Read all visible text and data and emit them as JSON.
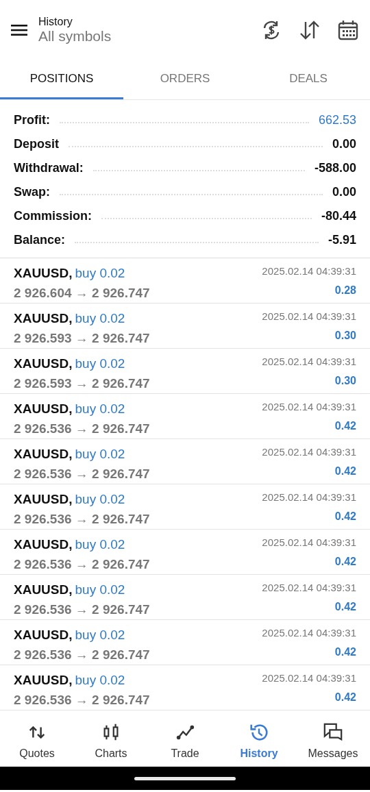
{
  "header": {
    "title": "History",
    "subtitle": "All symbols"
  },
  "tabs": [
    {
      "label": "POSITIONS",
      "selected": true
    },
    {
      "label": "ORDERS",
      "selected": false
    },
    {
      "label": "DEALS",
      "selected": false
    }
  ],
  "summary": [
    {
      "label": "Profit:",
      "value": "662.53",
      "kind": "highlight"
    },
    {
      "label": "Deposit",
      "value": "0.00",
      "kind": "plain"
    },
    {
      "label": "Withdrawal:",
      "value": "-588.00",
      "kind": "plain"
    },
    {
      "label": "Swap:",
      "value": "0.00",
      "kind": "plain"
    },
    {
      "label": "Commission:",
      "value": "-80.44",
      "kind": "plain"
    },
    {
      "label": "Balance:",
      "value": "-5.91",
      "kind": "plain"
    }
  ],
  "positions": [
    {
      "symbol": "XAUUSD,",
      "side": "buy 0.02",
      "prices": "2 926.604 → 2 926.747",
      "time": "2025.02.14 04:39:31",
      "profit": "0.28"
    },
    {
      "symbol": "XAUUSD,",
      "side": "buy 0.02",
      "prices": "2 926.593 → 2 926.747",
      "time": "2025.02.14 04:39:31",
      "profit": "0.30"
    },
    {
      "symbol": "XAUUSD,",
      "side": "buy 0.02",
      "prices": "2 926.593 → 2 926.747",
      "time": "2025.02.14 04:39:31",
      "profit": "0.30"
    },
    {
      "symbol": "XAUUSD,",
      "side": "buy 0.02",
      "prices": "2 926.536 → 2 926.747",
      "time": "2025.02.14 04:39:31",
      "profit": "0.42"
    },
    {
      "symbol": "XAUUSD,",
      "side": "buy 0.02",
      "prices": "2 926.536 → 2 926.747",
      "time": "2025.02.14 04:39:31",
      "profit": "0.42"
    },
    {
      "symbol": "XAUUSD,",
      "side": "buy 0.02",
      "prices": "2 926.536 → 2 926.747",
      "time": "2025.02.14 04:39:31",
      "profit": "0.42"
    },
    {
      "symbol": "XAUUSD,",
      "side": "buy 0.02",
      "prices": "2 926.536 → 2 926.747",
      "time": "2025.02.14 04:39:31",
      "profit": "0.42"
    },
    {
      "symbol": "XAUUSD,",
      "side": "buy 0.02",
      "prices": "2 926.536 → 2 926.747",
      "time": "2025.02.14 04:39:31",
      "profit": "0.42"
    },
    {
      "symbol": "XAUUSD,",
      "side": "buy 0.02",
      "prices": "2 926.536 → 2 926.747",
      "time": "2025.02.14 04:39:31",
      "profit": "0.42"
    },
    {
      "symbol": "XAUUSD,",
      "side": "buy 0.02",
      "prices": "2 926.536 → 2 926.747",
      "time": "2025.02.14 04:39:31",
      "profit": "0.42"
    }
  ],
  "bottom_nav": [
    {
      "label": "Quotes",
      "kind": "quotes",
      "selected": false
    },
    {
      "label": "Charts",
      "kind": "charts",
      "selected": false
    },
    {
      "label": "Trade",
      "kind": "trade",
      "selected": false
    },
    {
      "label": "History",
      "kind": "history",
      "selected": true
    },
    {
      "label": "Messages",
      "kind": "messages",
      "selected": false
    }
  ]
}
